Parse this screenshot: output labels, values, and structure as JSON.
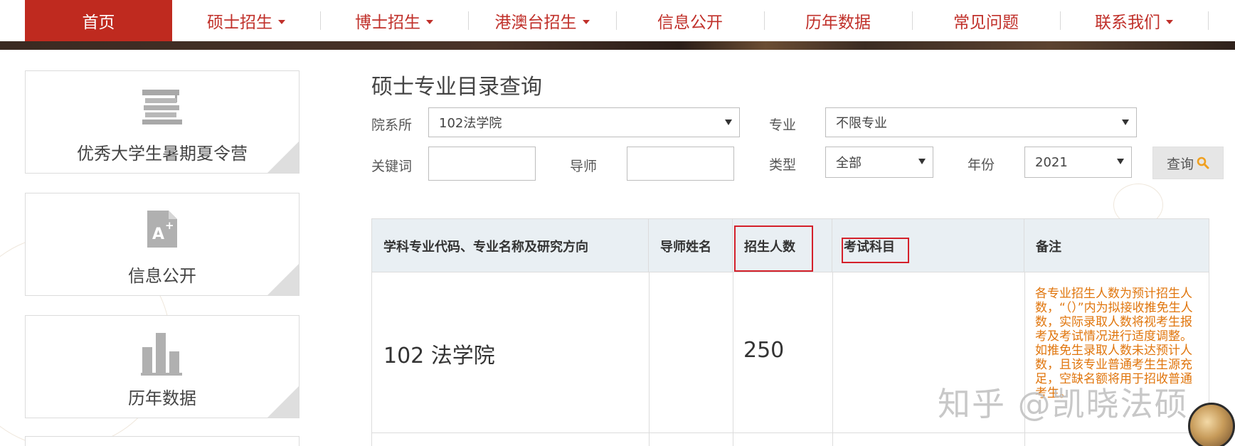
{
  "nav": {
    "items": [
      {
        "label": "首页",
        "dropdown": false,
        "active": true
      },
      {
        "label": "硕士招生",
        "dropdown": true,
        "active": false
      },
      {
        "label": "博士招生",
        "dropdown": true,
        "active": false
      },
      {
        "label": "港澳台招生",
        "dropdown": true,
        "active": false
      },
      {
        "label": "信息公开",
        "dropdown": false,
        "active": false
      },
      {
        "label": "历年数据",
        "dropdown": false,
        "active": false
      },
      {
        "label": "常见问题",
        "dropdown": false,
        "active": false
      },
      {
        "label": "联系我们",
        "dropdown": true,
        "active": false
      }
    ],
    "active_color": "#bf2a1f",
    "text_color": "#c0302a"
  },
  "sidebar": {
    "cards": [
      {
        "label": "优秀大学生暑期夏令营",
        "icon": "graduation-cap-books-icon"
      },
      {
        "label": "信息公开",
        "icon": "document-a-plus-icon"
      },
      {
        "label": "历年数据",
        "icon": "bar-chart-icon"
      }
    ]
  },
  "search": {
    "title": "硕士专业目录查询",
    "department_label": "院系所",
    "department_value": "102法学院",
    "major_label": "专业",
    "major_value": "不限专业",
    "keyword_label": "关键词",
    "keyword_value": "",
    "advisor_label": "导师",
    "advisor_value": "",
    "type_label": "类型",
    "type_value": "全部",
    "year_label": "年份",
    "year_value": "2021",
    "query_button": "查询",
    "query_icon": "search-icon",
    "query_icon_color": "#f0a020"
  },
  "table": {
    "headers": [
      "学科专业代码、专业名称及研究方向",
      "导师姓名",
      "招生人数",
      "考试科目",
      "备注"
    ],
    "rows": [
      {
        "major": "102 法学院",
        "advisor": "",
        "enrollment": "250",
        "exam_subjects": "",
        "note": "各专业招生人数为预计招生人数，“（）”内为拟接收推免生人数，实际录取人数将视考生报考及考试情况进行适度调整。如推免生录取人数未达预计人数，且该专业普通考生生源充足，空缺名额将用于招收普通考生。"
      }
    ],
    "note_color": "#e0750c",
    "highlight_color": "#d4202a"
  },
  "watermark": {
    "text": "知乎 @凯晓法硕"
  }
}
